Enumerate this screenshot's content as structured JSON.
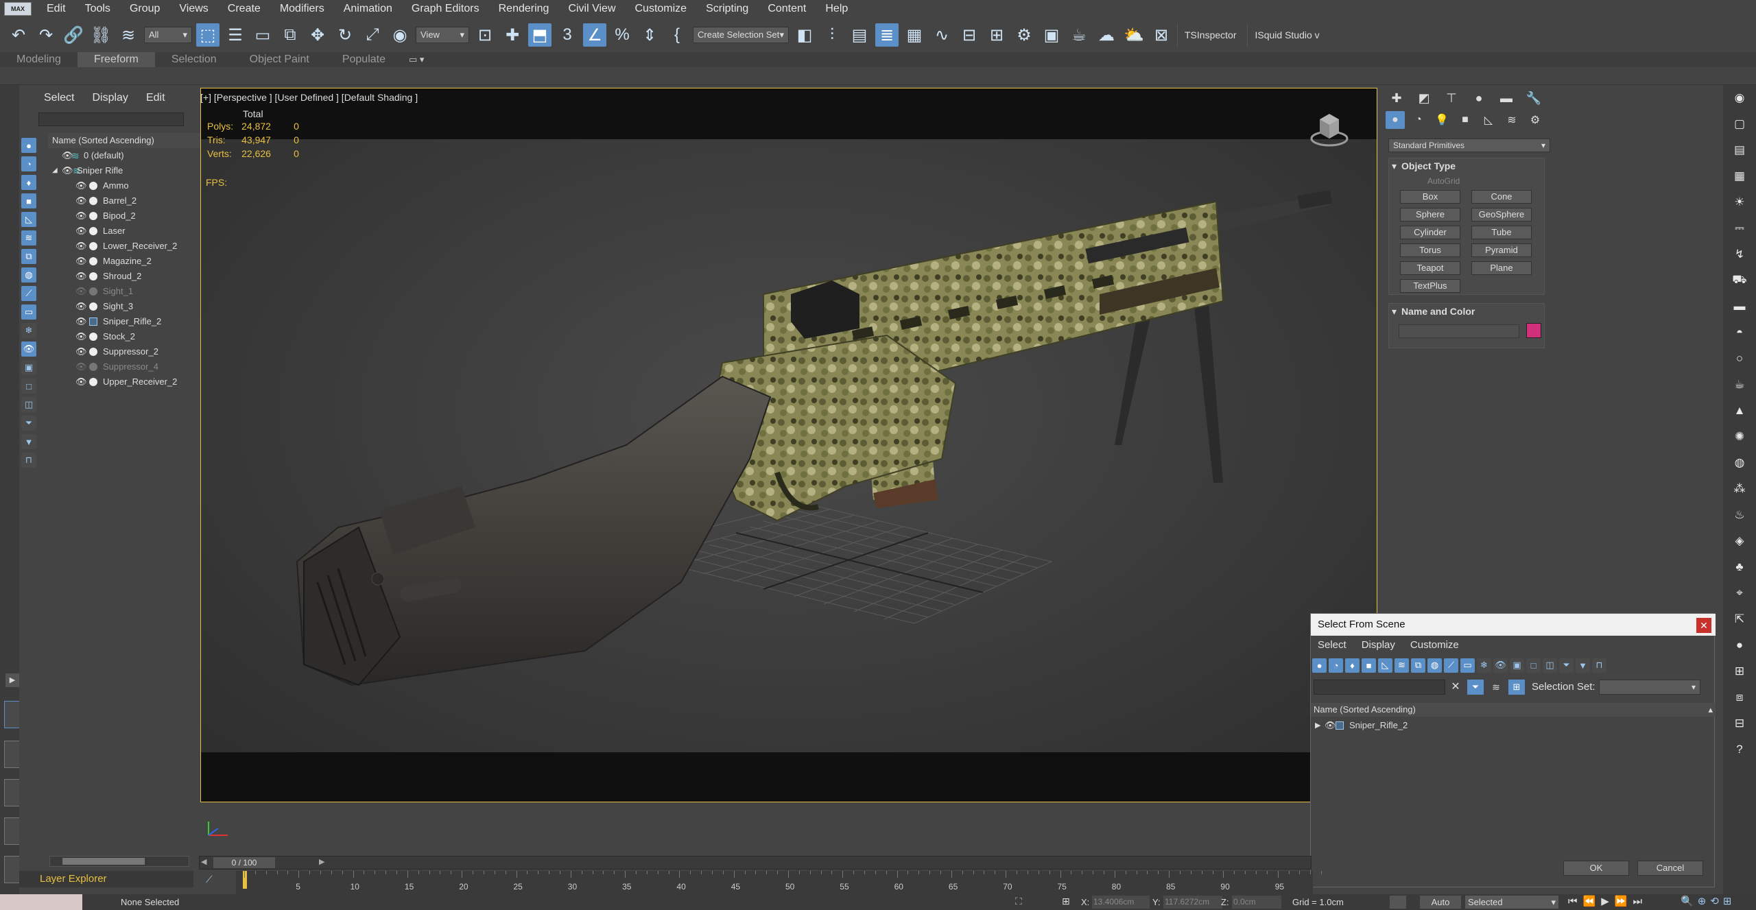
{
  "menu": [
    "Edit",
    "Tools",
    "Group",
    "Views",
    "Create",
    "Modifiers",
    "Animation",
    "Graph Editors",
    "Rendering",
    "Civil View",
    "Customize",
    "Scripting",
    "Content",
    "Help"
  ],
  "app_icon_label": "MAX",
  "toolbar": {
    "filter_dropdown": "All",
    "view_dropdown": "View",
    "selection_set_dropdown": "Create Selection Set",
    "plugin1": "TSInspector",
    "plugin2": "ISquid Studio v"
  },
  "ribbon_tabs": [
    "Modeling",
    "Freeform",
    "Selection",
    "Object Paint",
    "Populate"
  ],
  "explorer": {
    "menu": [
      "Select",
      "Display",
      "Edit"
    ],
    "tree_header": "Name (Sorted Ascending)",
    "rows": [
      {
        "label": "0 (default)",
        "indent": 0,
        "type": "layer",
        "dim": false
      },
      {
        "label": "Sniper Rifle",
        "indent": 1,
        "type": "layer",
        "dim": false
      },
      {
        "label": "Ammo",
        "indent": 2,
        "type": "obj",
        "dim": false
      },
      {
        "label": "Barrel_2",
        "indent": 2,
        "type": "obj",
        "dim": false
      },
      {
        "label": "Bipod_2",
        "indent": 2,
        "type": "obj",
        "dim": false
      },
      {
        "label": "Laser",
        "indent": 2,
        "type": "obj",
        "dim": false
      },
      {
        "label": "Lower_Receiver_2",
        "indent": 2,
        "type": "obj",
        "dim": false
      },
      {
        "label": "Magazine_2",
        "indent": 2,
        "type": "obj",
        "dim": false
      },
      {
        "label": "Shroud_2",
        "indent": 2,
        "type": "obj",
        "dim": false
      },
      {
        "label": "Sight_1",
        "indent": 2,
        "type": "obj",
        "dim": true
      },
      {
        "label": "Sight_3",
        "indent": 2,
        "type": "obj",
        "dim": false
      },
      {
        "label": "Sniper_Rifle_2",
        "indent": 2,
        "type": "group",
        "dim": false
      },
      {
        "label": "Stock_2",
        "indent": 2,
        "type": "obj",
        "dim": false
      },
      {
        "label": "Suppressor_2",
        "indent": 2,
        "type": "obj",
        "dim": false
      },
      {
        "label": "Suppressor_4",
        "indent": 2,
        "type": "obj",
        "dim": true
      },
      {
        "label": "Upper_Receiver_2",
        "indent": 2,
        "type": "obj",
        "dim": false
      }
    ],
    "footer": "Layer Explorer"
  },
  "viewport": {
    "label": "[+] [Perspective ] [User Defined ] [Default Shading ]",
    "stats_header": "Total",
    "stats": [
      {
        "name": "Polys:",
        "total": "24,872",
        "sel": "0"
      },
      {
        "name": "Tris:",
        "total": "43,947",
        "sel": "0"
      },
      {
        "name": "Verts:",
        "total": "22,626",
        "sel": "0"
      }
    ],
    "fps_label": "FPS:"
  },
  "command_panel": {
    "category": "Standard Primitives",
    "object_type_title": "Object Type",
    "autogrid": "AutoGrid",
    "primitives": [
      "Box",
      "Cone",
      "Sphere",
      "GeoSphere",
      "Cylinder",
      "Tube",
      "Torus",
      "Pyramid",
      "Teapot",
      "Plane",
      "TextPlus"
    ],
    "name_color_title": "Name and Color",
    "object_color": "#d0307a"
  },
  "dialog": {
    "title": "Select From Scene",
    "menu": [
      "Select",
      "Display",
      "Customize"
    ],
    "selection_set_label": "Selection Set:",
    "tree_header": "Name (Sorted Ascending)",
    "row": "Sniper_Rifle_2",
    "ok": "OK",
    "cancel": "Cancel"
  },
  "timeline": {
    "position": "0 / 100",
    "ticks": [
      "0",
      "5",
      "10",
      "15",
      "20",
      "25",
      "30",
      "35",
      "40",
      "45",
      "50",
      "55",
      "60",
      "65",
      "70",
      "75",
      "80",
      "85",
      "90",
      "95"
    ]
  },
  "status": {
    "selection": "None Selected",
    "x_label": "X:",
    "x_value": "13.4006cm",
    "y_label": "Y:",
    "y_value": "117.6272cm",
    "z_label": "Z:",
    "z_value": "0.0cm",
    "grid": "Grid = 1.0cm",
    "auto": "Auto",
    "selected_dropdown": "Selected"
  },
  "colors": {
    "accent": "#5b8fc7",
    "viewport_border": "#e8c040",
    "close": "#c8302c"
  }
}
